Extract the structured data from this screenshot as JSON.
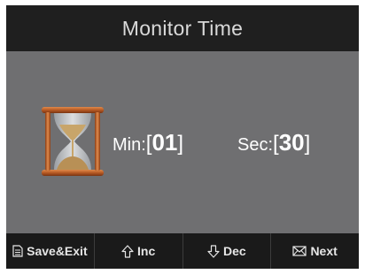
{
  "header": {
    "title": "Monitor Time"
  },
  "timer": {
    "icon": "hourglass-icon",
    "min_label": "Min:",
    "min_value": "01",
    "sec_label": "Sec:",
    "sec_value": "30",
    "open_bracket": "[",
    "close_bracket": "]"
  },
  "softkeys": [
    {
      "label": "Save&Exit",
      "icon": "document-icon"
    },
    {
      "label": "Inc",
      "icon": "arrow-up-icon"
    },
    {
      "label": "Dec",
      "icon": "arrow-down-icon"
    },
    {
      "label": "Next",
      "icon": "envelope-icon"
    }
  ],
  "colors": {
    "background": "#6f6f71",
    "title_bar": "#1f1f1f",
    "bottom_bar": "#1a1a1a",
    "hourglass_wood": "#b9612e"
  }
}
